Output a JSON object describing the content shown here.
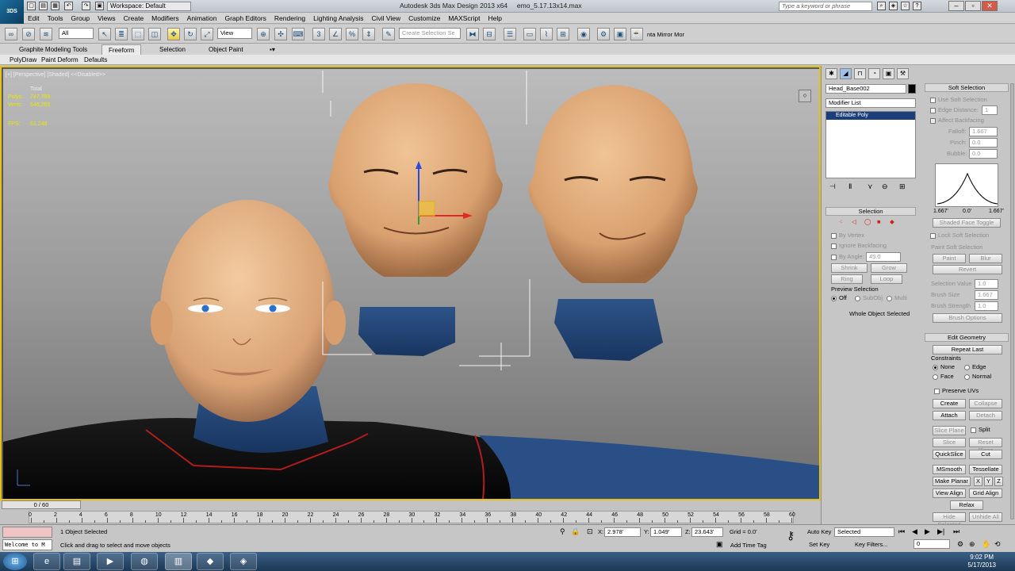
{
  "titlebar": {
    "app_title": "Autodesk 3ds Max Design 2013 x64",
    "file_name": "emo_5.17.13x14.max",
    "workspace_label": "Workspace: Default",
    "search_placeholder": "Type a keyword or phrase",
    "logo_text": "3DS"
  },
  "menus": [
    "Edit",
    "Tools",
    "Group",
    "Views",
    "Create",
    "Modifiers",
    "Animation",
    "Graph Editors",
    "Rendering",
    "Lighting Analysis",
    "Civil View",
    "Customize",
    "MAXScript",
    "Help"
  ],
  "toolbar": {
    "selection_filter": "All",
    "ref_coord": "View",
    "named_selection_placeholder": "Create Selection Se",
    "mirror_label": "nta Mirror Mor"
  },
  "ribbon": {
    "tabs": [
      "Graphite Modeling Tools",
      "Freeform",
      "Selection",
      "Object Paint"
    ],
    "active_tab": "Freeform",
    "subtabs": [
      "PolyDraw",
      "Paint Deform",
      "Defaults"
    ]
  },
  "viewport": {
    "label": "[+] [Perspective] [Shaded] <<Disabled>>",
    "stats_total": "Total",
    "polys_label": "Polys:",
    "polys_value": "747,789",
    "verts_label": "Verts:",
    "verts_value": "646,265",
    "fps_label": "FPS:",
    "fps_value": "61.248"
  },
  "command_panel": {
    "object_name": "Head_Base002",
    "modifier_list_label": "Modifier List",
    "stack_item": "Editable Poly",
    "selection": {
      "title": "Selection",
      "by_vertex": "By Vertex",
      "ignore_backfacing": "Ignore Backfacing",
      "by_angle": "By Angle:",
      "by_angle_value": "45.0",
      "shrink": "Shrink",
      "grow": "Grow",
      "ring": "Ring",
      "loop": "Loop",
      "preview_title": "Preview Selection",
      "preview_off": "Off",
      "preview_subobj": "SubObj",
      "preview_multi": "Multi",
      "status": "Whole Object Selected"
    },
    "soft_selection": {
      "title": "Soft Selection",
      "use_soft": "Use Soft Selection",
      "edge_distance": "Edge Distance:",
      "edge_distance_value": "1",
      "affect_backfacing": "Affect Backfacing",
      "falloff": "Falloff:",
      "falloff_value": "1.667",
      "pinch": "Pinch:",
      "pinch_value": "0.0",
      "bubble": "Bubble:",
      "bubble_value": "0.0",
      "curve_left": "1.667'",
      "curve_mid": "0.0'",
      "curve_right": "1.667'",
      "shaded_face": "Shaded Face Toggle",
      "lock": "Lock Soft Selection",
      "paint_title": "Paint Soft Selection",
      "paint": "Paint",
      "blur": "Blur",
      "revert": "Revert",
      "sel_value": "Selection Value",
      "sel_value_v": "1.0",
      "brush_size": "Brush Size",
      "brush_size_v": "1.667",
      "brush_strength": "Brush Strength",
      "brush_strength_v": "1.0",
      "brush_options": "Brush Options"
    },
    "edit_geometry": {
      "title": "Edit Geometry",
      "repeat_last": "Repeat Last",
      "constraints": "Constraints",
      "none": "None",
      "edge": "Edge",
      "face": "Face",
      "normal": "Normal",
      "preserve_uvs": "Preserve UVs",
      "create": "Create",
      "collapse": "Collapse",
      "attach": "Attach",
      "detach": "Detach",
      "slice_plane": "Slice Plane",
      "split": "Split",
      "slice": "Slice",
      "reset_plane": "Reset Plane",
      "quickslice": "QuickSlice",
      "cut": "Cut",
      "msmooth": "MSmooth",
      "tessellate": "Tessellate",
      "make_planar": "Make Planar",
      "x": "X",
      "y": "Y",
      "z": "Z",
      "view_align": "View Align",
      "grid_align": "Grid Align",
      "relax": "Relax",
      "hide_selected": "Hide Selected",
      "unhide_all": "Unhide All"
    }
  },
  "timeline": {
    "slider": "0 / 60",
    "ticks": [
      "0",
      "2",
      "4",
      "6",
      "8",
      "10",
      "12",
      "14",
      "16",
      "18",
      "20",
      "22",
      "24",
      "26",
      "28",
      "30",
      "32",
      "34",
      "36",
      "38",
      "40",
      "42",
      "44",
      "46",
      "48",
      "50",
      "52",
      "54",
      "56",
      "58",
      "60"
    ]
  },
  "status": {
    "selected": "1 Object Selected",
    "prompt": "Click and drag to select and move objects",
    "listener": "Welcome to M",
    "x_label": "X:",
    "x_value": "2.978'",
    "y_label": "Y:",
    "y_value": "1.049'",
    "z_label": "Z:",
    "z_value": "23.643'",
    "grid": "Grid = 0.0'",
    "add_time_tag": "Add Time Tag",
    "auto_key": "Auto Key",
    "auto_key_mode": "Selected",
    "set_key": "Set Key",
    "key_filters": "Key Filters...",
    "frame": "0"
  },
  "taskbar": {
    "time": "9:02 PM",
    "date": "5/17/2013"
  }
}
